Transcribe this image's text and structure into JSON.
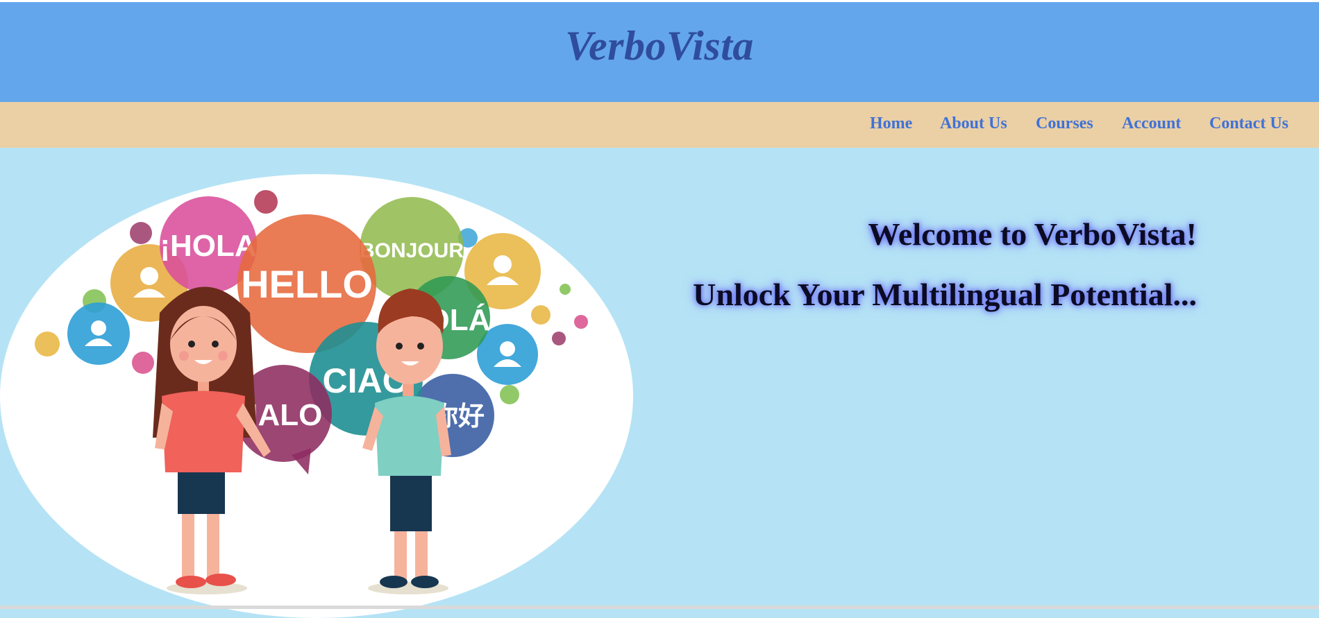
{
  "header": {
    "brand": "VerboVista"
  },
  "nav": {
    "items": [
      {
        "label": "Home"
      },
      {
        "label": "About Us"
      },
      {
        "label": "Courses"
      },
      {
        "label": "Account"
      },
      {
        "label": "Contact Us"
      }
    ]
  },
  "hero": {
    "welcome": "Welcome to VerboVista!",
    "tagline": "Unlock Your Multilingual Potential...",
    "bubbles": {
      "hola": "¡HOLA",
      "hello": "HELLO",
      "bonjour": "BONJOUR",
      "ola": "OLÁ",
      "ciao": "CIAO",
      "halo": "HALO",
      "nihao": "你好"
    }
  },
  "colors": {
    "header_bg": "#63a6ec",
    "nav_bg": "#ebcfa5",
    "page_bg": "#b5e3f5",
    "brand": "#2f4d9c",
    "nav_link": "#3f72d6"
  },
  "icons": [
    "person-icon"
  ]
}
